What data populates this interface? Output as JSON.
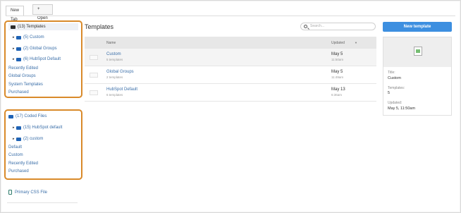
{
  "tabs": {
    "active": "New Tab",
    "open_new": "+ Open new tab"
  },
  "sidebar": {
    "templates_group": {
      "header": "(13) Templates",
      "folders": [
        "(5) Custom",
        "(2) Global Groups",
        "(6) HubSpot Default"
      ],
      "links": [
        "Recently Edited",
        "Global Groups",
        "System Templates",
        "Purchased"
      ]
    },
    "coded_group": {
      "header": "(17) Coded Files",
      "folders": [
        "(15) HubSpot default",
        "(2) custom"
      ],
      "links": [
        "Default",
        "Custom",
        "Recently Edited",
        "Purchased"
      ]
    },
    "primary_css": "Primary CSS File"
  },
  "main": {
    "title": "Templates",
    "search_placeholder": "Search...",
    "new_template_label": "New template",
    "columns": {
      "name": "Name",
      "updated": "Updated",
      "sort_indicator": "▼"
    },
    "rows": [
      {
        "name": "Custom",
        "count": "5 templates",
        "date": "May 5",
        "time": "11:50am"
      },
      {
        "name": "Global Groups",
        "count": "2 templates",
        "date": "May 5",
        "time": "11:49am"
      },
      {
        "name": "HubSpot Default",
        "count": "6 templates",
        "date": "May 13",
        "time": "6:36am"
      }
    ]
  },
  "details": {
    "title_label": "Title:",
    "title_value": "Custom",
    "templates_label": "Templates:",
    "templates_value": "5",
    "updated_label": "Updated:",
    "updated_value": "May 5, 11:50am"
  },
  "colors": {
    "accent": "#3d8fe0",
    "highlight_outline": "#d98a2a",
    "link": "#3a6ea8"
  }
}
